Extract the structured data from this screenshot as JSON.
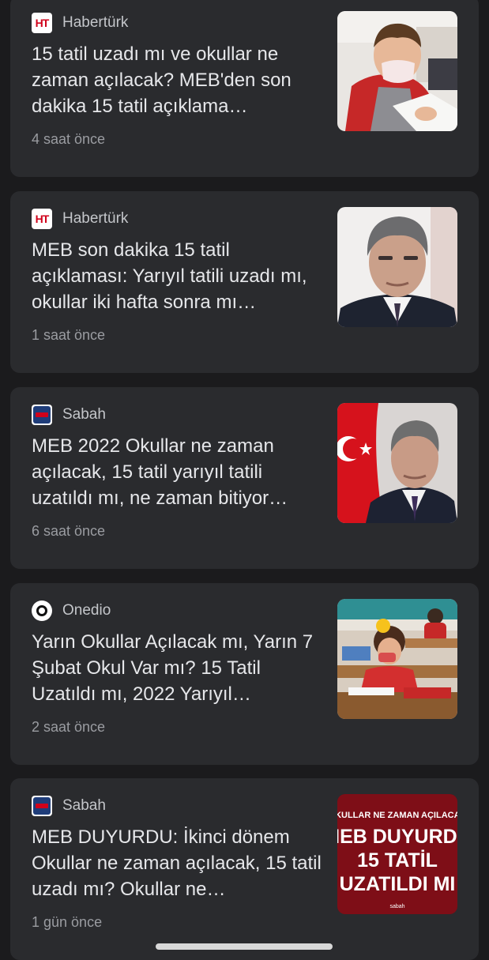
{
  "articles": [
    {
      "source": "Habertürk",
      "source_icon": "habertürk-logo-icon",
      "headline": "15 tatil uzadı mı ve okullar ne zaman açılacak? MEB'den son dakika 15 tatil açıklama…",
      "time": "4 saat önce",
      "thumbnail": "classroom-child-with-mask-image"
    },
    {
      "source": "Habertürk",
      "source_icon": "habertürk-logo-icon",
      "headline": "MEB son dakika 15 tatil açıklaması: Yarıyıl tatili uzadı mı, okullar iki hafta sonra mı…",
      "time": "1 saat önce",
      "thumbnail": "minister-portrait-image"
    },
    {
      "source": "Sabah",
      "source_icon": "sabah-logo-icon",
      "headline": "MEB 2022 Okullar ne zaman açılacak, 15 tatil yarıyıl tatili uzatıldı mı, ne zaman bitiyor…",
      "time": "6 saat önce",
      "thumbnail": "minister-with-turkish-flag-image"
    },
    {
      "source": "Onedio",
      "source_icon": "onedio-logo-icon",
      "headline": "Yarın Okullar Açılacak mı, Yarın 7 Şubat Okul Var mı? 15 Tatil Uzatıldı mı, 2022 Yarıyıl…",
      "time": "2 saat önce",
      "thumbnail": "students-in-classroom-image"
    },
    {
      "source": "Sabah",
      "source_icon": "sabah-logo-icon",
      "headline": "MEB DUYURDU: İkinci dönem Okullar ne zaman açılacak, 15 tatil uzadı mı? Okullar ne…",
      "time": "1 gün önce",
      "thumbnail": "announcement-graphic-image",
      "thumbnail_text": {
        "line1": "OKULLAR NE ZAMAN AÇILACAK",
        "line2": "MEB DUYURDU",
        "line3": "15 TATİL",
        "line4": "UZATILDI MI",
        "credit": "sabah"
      }
    }
  ]
}
